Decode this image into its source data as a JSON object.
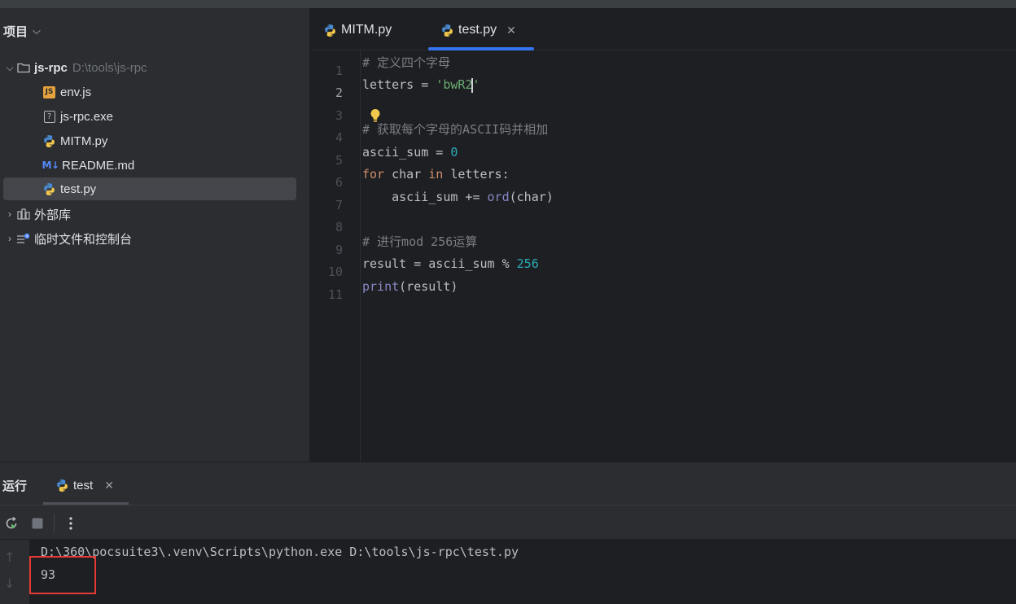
{
  "project": {
    "header": "项目",
    "root": {
      "name": "js-rpc",
      "path": "D:\\tools\\js-rpc"
    },
    "files": [
      {
        "name": "env.js",
        "icon": "js-file-icon"
      },
      {
        "name": "js-rpc.exe",
        "icon": "unknown-file-icon"
      },
      {
        "name": "MITM.py",
        "icon": "python-file-icon"
      },
      {
        "name": "README.md",
        "icon": "markdown-file-icon"
      },
      {
        "name": "test.py",
        "icon": "python-file-icon",
        "selected": true
      }
    ],
    "external_libs": "外部库",
    "scratches": "临时文件和控制台"
  },
  "editor": {
    "tabs": [
      {
        "label": "MITM.py",
        "active": false
      },
      {
        "label": "test.py",
        "active": true,
        "close": "✕"
      }
    ],
    "line_numbers": [
      "1",
      "2",
      "3",
      "4",
      "5",
      "6",
      "7",
      "8",
      "9",
      "10",
      "11"
    ],
    "active_line": "2",
    "code": {
      "l1": "# 定义四个字母",
      "l2_pre": "letters = ",
      "l2_str_a": "'bwR2",
      "l2_str_b": "'",
      "l4": "# 获取每个字母的ASCII码并相加",
      "l5_pre": "ascii_sum = ",
      "l5_num": "0",
      "l6_kw1": "for",
      "l6_mid": " char ",
      "l6_kw2": "in",
      "l6_end": " letters:",
      "l7_pre": "    ascii_sum += ",
      "l7_fn": "ord",
      "l7_end": "(char)",
      "l9": "# 进行mod 256运算",
      "l10_pre": "result = ascii_sum % ",
      "l10_num": "256",
      "l11_fn": "print",
      "l11_end": "(result)"
    }
  },
  "run": {
    "title": "运行",
    "tab_label": "test",
    "tab_close": "✕",
    "command": "D:\\360\\pocsuite3\\.venv\\Scripts\\python.exe D:\\tools\\js-rpc\\test.py",
    "output": "93"
  },
  "colors": {
    "accent": "#3574f0",
    "highlight_box": "#e53935"
  }
}
